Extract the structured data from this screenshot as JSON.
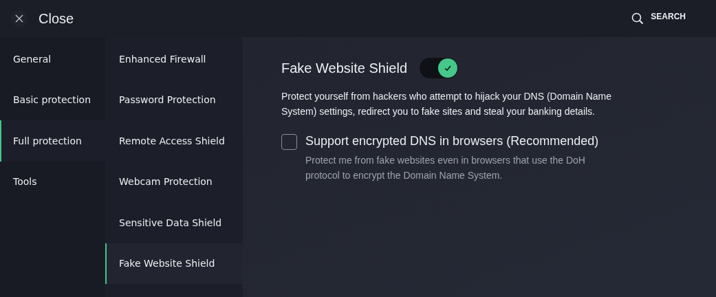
{
  "header": {
    "close_label": "Close",
    "search_label": "SEARCH"
  },
  "categories": [
    {
      "label": "General",
      "selected": false
    },
    {
      "label": "Basic protection",
      "selected": false
    },
    {
      "label": "Full protection",
      "selected": true
    },
    {
      "label": "Tools",
      "selected": false
    }
  ],
  "features": [
    {
      "label": "Enhanced Firewall",
      "selected": false
    },
    {
      "label": "Password Protection",
      "selected": false
    },
    {
      "label": "Remote Access Shield",
      "selected": false
    },
    {
      "label": "Webcam Protection",
      "selected": false
    },
    {
      "label": "Sensitive Data Shield",
      "selected": false
    },
    {
      "label": "Fake Website Shield",
      "selected": true
    }
  ],
  "detail": {
    "title": "Fake Website Shield",
    "on": true,
    "description": "Protect yourself from hackers who attempt to hijack your DNS (Domain Name System) settings, redirect you to fake sites and steal your banking details.",
    "options": [
      {
        "label": "Support encrypted DNS in browsers (Recommended)",
        "checked": false,
        "hint": "Protect me from fake websites even in browsers that use the DoH protocol to encrypt the Domain Name System."
      }
    ]
  }
}
